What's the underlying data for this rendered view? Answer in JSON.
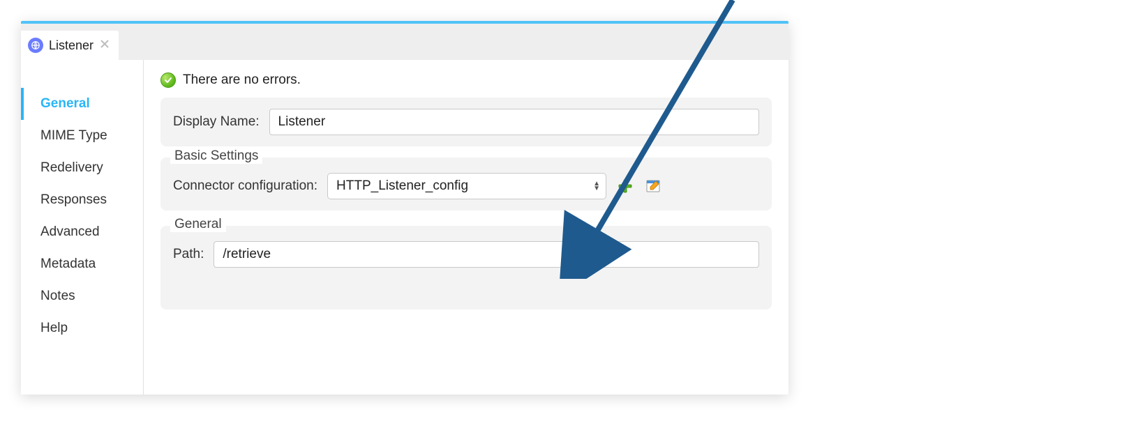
{
  "tab": {
    "title": "Listener",
    "icon": "globe-icon"
  },
  "sidebar": {
    "items": [
      {
        "label": "General",
        "active": true
      },
      {
        "label": "MIME Type",
        "active": false
      },
      {
        "label": "Redelivery",
        "active": false
      },
      {
        "label": "Responses",
        "active": false
      },
      {
        "label": "Advanced",
        "active": false
      },
      {
        "label": "Metadata",
        "active": false
      },
      {
        "label": "Notes",
        "active": false
      },
      {
        "label": "Help",
        "active": false
      }
    ]
  },
  "status": {
    "message": "There are no errors.",
    "ok": true
  },
  "form": {
    "displayName": {
      "label": "Display Name:",
      "value": "Listener"
    },
    "basicSettings": {
      "legend": "Basic Settings",
      "connectorConfig": {
        "label": "Connector configuration:",
        "value": "HTTP_Listener_config"
      }
    },
    "general": {
      "legend": "General",
      "path": {
        "label": "Path:",
        "value": "/retrieve"
      }
    }
  },
  "icons": {
    "add": "plus-icon",
    "edit": "edit-icon",
    "close": "close-icon",
    "checkmark": "check-icon"
  },
  "colors": {
    "accent": "#29b6f6",
    "arrow": "#1e5a8e"
  }
}
